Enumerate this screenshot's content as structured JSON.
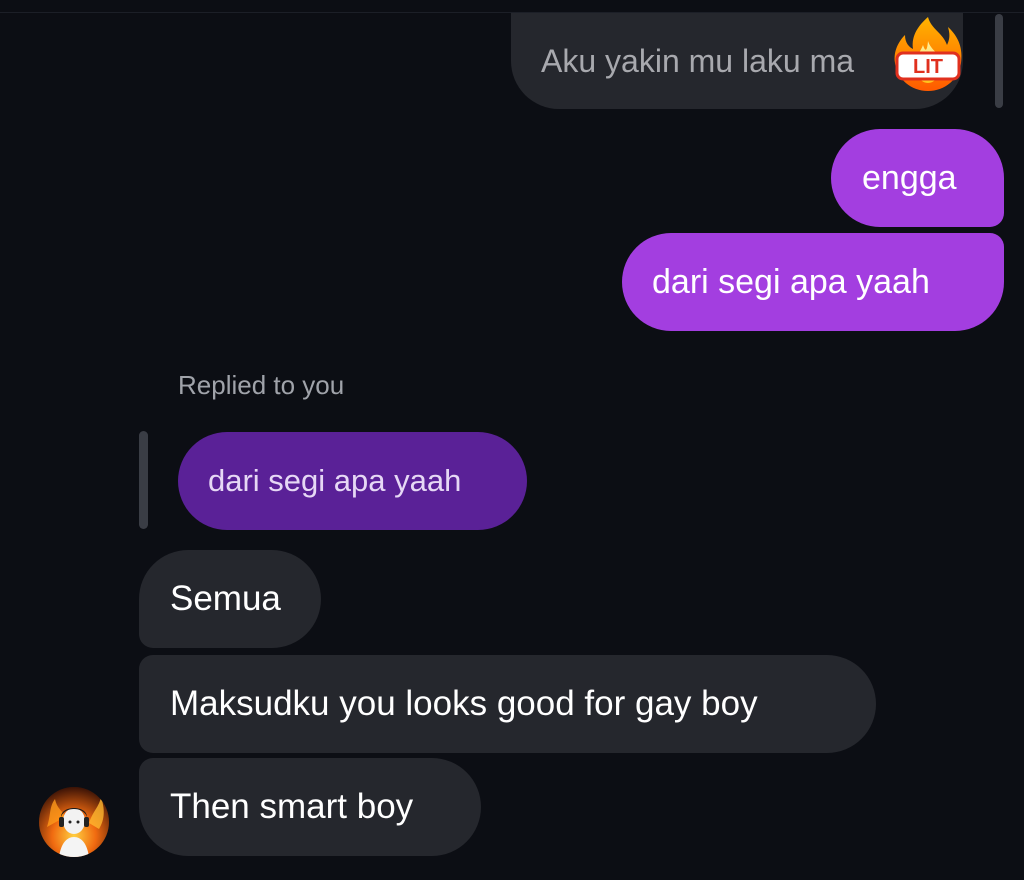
{
  "conversation": {
    "messages": [
      {
        "id": "aku",
        "sender": "them",
        "text": "Aku yakin mu laku ma",
        "emoji": "lit-fire-emoji"
      },
      {
        "id": "engga",
        "sender": "me",
        "text": "engga"
      },
      {
        "id": "dari-out",
        "sender": "me",
        "text": "dari segi apa yaah"
      },
      {
        "id": "semua",
        "sender": "them",
        "text": "Semua"
      },
      {
        "id": "maksudku",
        "sender": "them",
        "text": "Maksudku you looks good for gay boy"
      },
      {
        "id": "then",
        "sender": "them",
        "text": "Then smart boy"
      }
    ],
    "reply": {
      "label": "Replied to you",
      "quoted_text": "dari segi apa yaah"
    },
    "emoji_label": "LIT"
  },
  "colors": {
    "background": "#0c0e14",
    "incoming_bubble": "#25272d",
    "outgoing_bubble": "#a33ee0",
    "reply_quote_bubble": "#5a2197",
    "secondary_text": "#a0a3aa"
  },
  "icons": {
    "avatar": "contact-avatar",
    "emoji": "lit-fire-emoji"
  }
}
